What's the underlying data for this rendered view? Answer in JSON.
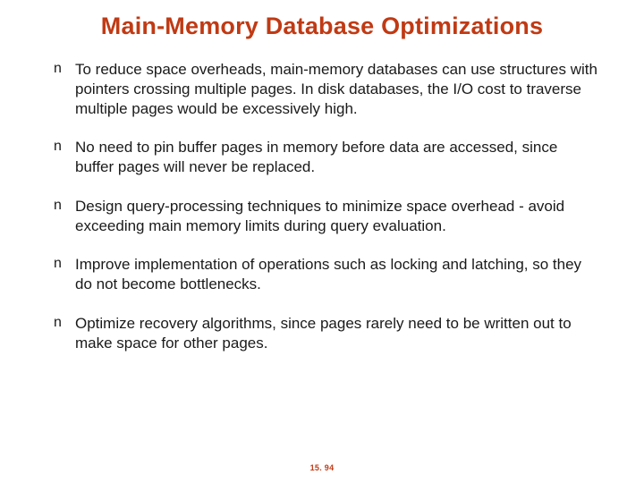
{
  "title": "Main-Memory Database Optimizations",
  "bullet_char": "n",
  "items": [
    "To reduce space overheads, main-memory databases can use structures with pointers crossing multiple pages. In disk databases, the I/O cost to traverse multiple pages would be excessively high.",
    "No need to pin buffer pages in memory before data are accessed, since buffer pages will never be replaced.",
    "Design query-processing techniques to minimize space overhead - avoid exceeding main memory limits during query evaluation.",
    "Improve implementation of operations such as locking and latching, so they do not become bottlenecks.",
    "Optimize recovery algorithms, since pages rarely need to be written out to make space for other pages."
  ],
  "page_number": "15. 94"
}
